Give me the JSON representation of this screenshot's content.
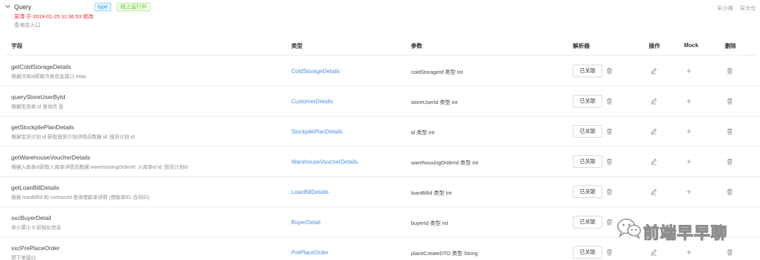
{
  "header": {
    "title": "Query",
    "tags": [
      "type",
      "线上运行中"
    ],
    "modified": "吴涛 于 2019-01-25 11:36:53 修改",
    "description": "查询总入口",
    "users": [
      "宋小福",
      "宋大仓"
    ]
  },
  "columns": {
    "field": "字段",
    "type": "类型",
    "param": "参数",
    "resolver": "解析器",
    "op": "操作",
    "mock": "Mock",
    "delete": "删除"
  },
  "rows": [
    {
      "name": "getColdStorageDetails",
      "desc": "根据冷库id获取冷库信息接口 miao",
      "type": "ColdStorageDetails",
      "param": "coldStorageId 类型 Int",
      "button": "已关联"
    },
    {
      "name": "queryStoreUserById",
      "desc": "根据宝货商 id 查询信 息",
      "type": "CustomerDetails",
      "param": "storeUserId 类型 Int",
      "button": "已关联"
    },
    {
      "name": "getStockpilePlanDetails",
      "desc": "根据宝货计划 id 获取囤货计划详情页数据 id: 囤货计划 id",
      "type": "StockpilePlanDetails",
      "param": "id 类型 Int",
      "button": "已关联"
    },
    {
      "name": "getWarehouseVoucherDetails",
      "desc": "根据入库单id获取入库单详情页数据 warehousingOrderId: 入库单id id: 囤货计划id",
      "type": "WarehouseVoucherDetails",
      "param": "warehousingOrderId 类型 Int",
      "button": "已关联"
    },
    {
      "name": "getLoanBillDetails",
      "desc": "根据 loanBillId 和 contractId 查询借款单详情 (借款单ID, 合同ID)",
      "type": "LoanBillDetails",
      "param": "loanBillId 类型 Int",
      "button": "已关联"
    },
    {
      "name": "sxcBuyerDetail",
      "desc": "宋小菜小 b 初始化信息",
      "type": "BuyerDetail",
      "param": "buyerId 类型 Int",
      "button": "已关联"
    },
    {
      "name": "sxcPrePlaceOrder",
      "desc": "预下单接口",
      "type": "PrePlaceOrder",
      "param": "placeCreateDTO 类型 String",
      "button": "已关联"
    }
  ],
  "watermark": {
    "text": "前端早早聊",
    "icon": "wechat-icon"
  },
  "colors": {
    "link": "#4a90e2",
    "modified_red": "#f5222d",
    "tag_blue": "#1890ff",
    "tag_green": "#52c41a"
  }
}
